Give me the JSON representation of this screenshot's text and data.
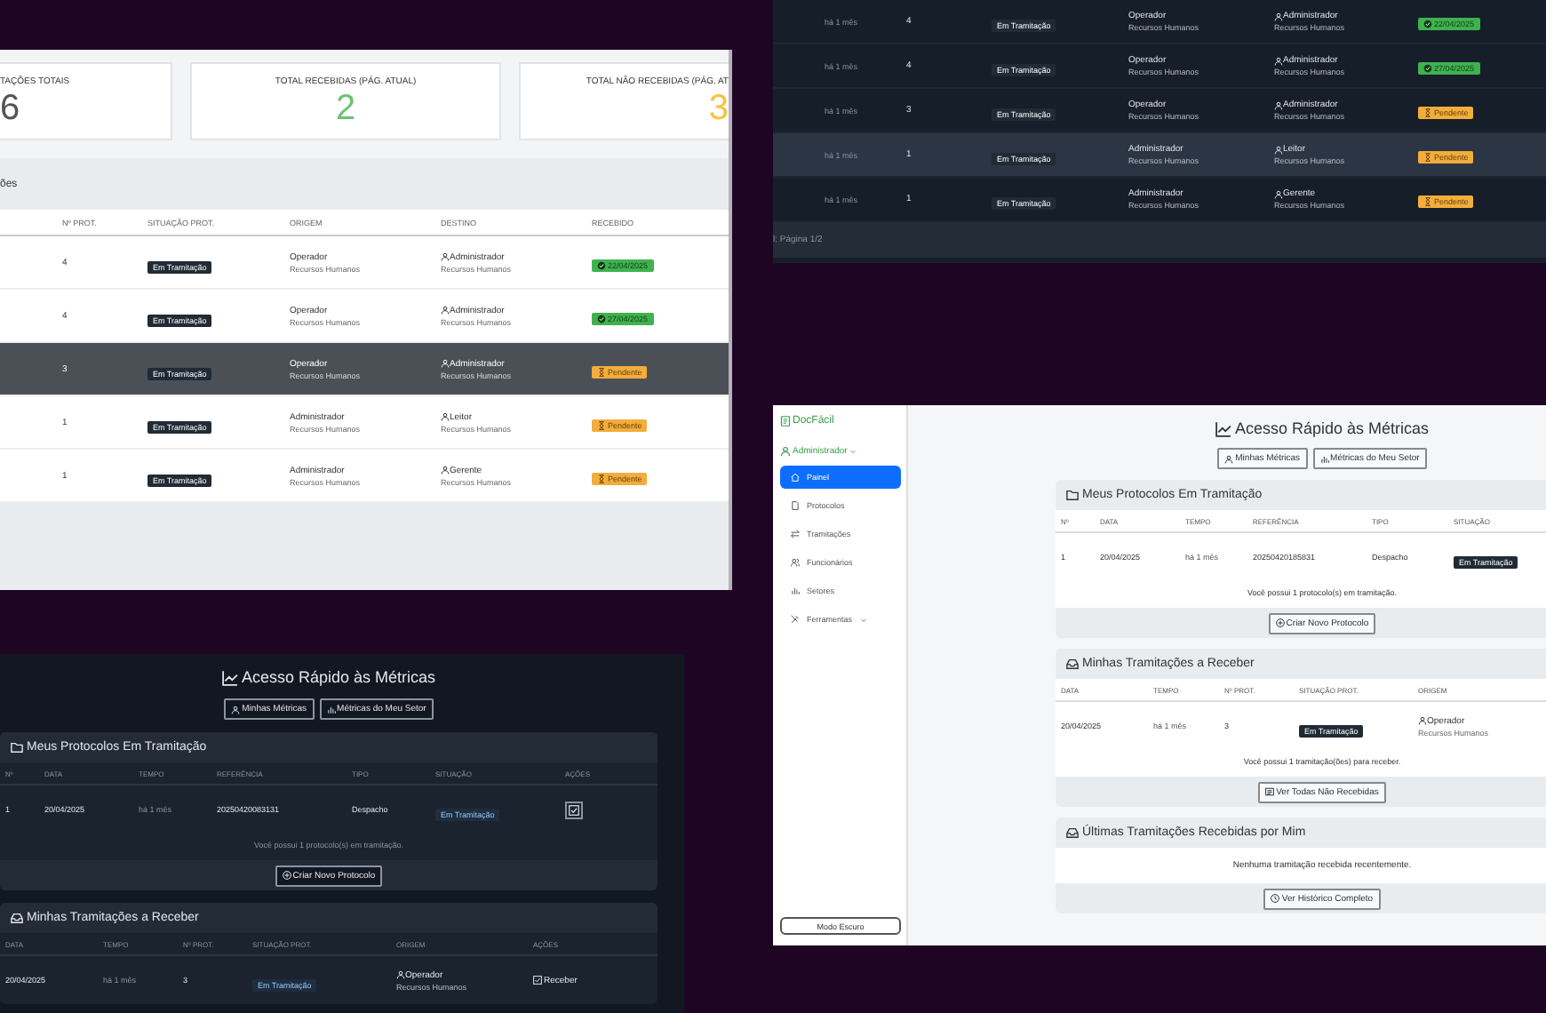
{
  "report_light": {
    "stat_cards": [
      {
        "label": "TAÇÕES TOTAIS",
        "value": "6",
        "kind": "total"
      },
      {
        "label": "TOTAL RECEBIDAS (PÁG. ATUAL)",
        "value": "2",
        "kind": "received"
      },
      {
        "label": "TOTAL NÃO RECEBIDAS (PÁG. AT",
        "value": "3",
        "kind": "pending"
      }
    ],
    "section_title": "ões",
    "columns": [
      "Nº PROT.",
      "SITUAÇÃO PROT.",
      "ORIGEM",
      "DESTINO",
      "RECEBIDO"
    ],
    "rows": [
      {
        "protocol": "4",
        "status": "Em Tramitação",
        "origin": "Operador",
        "origin_sector": "Recursos Humanos",
        "destination": "Administrador",
        "destination_sector": "Recursos Humanos",
        "received": true,
        "received_label": "22/04/2025",
        "highlighted": false
      },
      {
        "protocol": "4",
        "status": "Em Tramitação",
        "origin": "Operador",
        "origin_sector": "Recursos Humanos",
        "destination": "Administrador",
        "destination_sector": "Recursos Humanos",
        "received": true,
        "received_label": "27/04/2025",
        "highlighted": false
      },
      {
        "protocol": "3",
        "status": "Em Tramitação",
        "origin": "Operador",
        "origin_sector": "Recursos Humanos",
        "destination": "Administrador",
        "destination_sector": "Recursos Humanos",
        "received": false,
        "received_label": "Pendente",
        "highlighted": true
      },
      {
        "protocol": "1",
        "status": "Em Tramitação",
        "origin": "Administrador",
        "origin_sector": "Recursos Humanos",
        "destination": "Leitor",
        "destination_sector": "Recursos Humanos",
        "received": false,
        "received_label": "Pendente",
        "highlighted": false
      },
      {
        "protocol": "1",
        "status": "Em Tramitação",
        "origin": "Administrador",
        "origin_sector": "Recursos Humanos",
        "destination": "Gerente",
        "destination_sector": "Recursos Humanos",
        "received": false,
        "received_label": "Pendente",
        "highlighted": false
      }
    ]
  },
  "report_dark": {
    "rows": [
      {
        "time": "há 1 mês",
        "protocol": "4",
        "status": "Em Tramitação",
        "origin": "Operador",
        "origin_sector": "Recursos Humanos",
        "destination": "Administrador",
        "destination_sector": "Recursos Humanos",
        "received": true,
        "received_label": "22/04/2025",
        "highlighted": false
      },
      {
        "time": "há 1 mês",
        "protocol": "4",
        "status": "Em Tramitação",
        "origin": "Operador",
        "origin_sector": "Recursos Humanos",
        "destination": "Administrador",
        "destination_sector": "Recursos Humanos",
        "received": true,
        "received_label": "27/04/2025",
        "highlighted": false
      },
      {
        "time": "há 1 mês",
        "protocol": "3",
        "status": "Em Tramitação",
        "origin": "Operador",
        "origin_sector": "Recursos Humanos",
        "destination": "Administrador",
        "destination_sector": "Recursos Humanos",
        "received": false,
        "received_label": "Pendente",
        "highlighted": false
      },
      {
        "time": "há 1 mês",
        "protocol": "1",
        "status": "Em Tramitação",
        "origin": "Administrador",
        "origin_sector": "Recursos Humanos",
        "destination": "Leitor",
        "destination_sector": "Recursos Humanos",
        "received": false,
        "received_label": "Pendente",
        "highlighted": true
      },
      {
        "time": "há 1 mês",
        "protocol": "1",
        "status": "Em Tramitação",
        "origin": "Administrador",
        "origin_sector": "Recursos Humanos",
        "destination": "Gerente",
        "destination_sector": "Recursos Humanos",
        "received": false,
        "received_label": "Pendente",
        "highlighted": false
      }
    ],
    "pagination": "l: Página 1/2"
  },
  "dashboard_light": {
    "sidebar": {
      "brand": "DocFácil",
      "user": "Administrador",
      "nav": [
        {
          "label": "Painel",
          "selected": true,
          "has_submenu": false
        },
        {
          "label": "Protocolos",
          "selected": false,
          "has_submenu": false
        },
        {
          "label": "Tramitações",
          "selected": false,
          "has_submenu": false
        },
        {
          "label": "Funcionários",
          "selected": false,
          "has_submenu": false
        },
        {
          "label": "Setores",
          "selected": false,
          "has_submenu": false
        },
        {
          "label": "Ferramentas",
          "selected": false,
          "has_submenu": true
        }
      ],
      "dark_mode_button": "Modo Escuro"
    },
    "heading": "Acesso Rápido às Métricas",
    "metric_buttons": [
      "Minhas Métricas",
      "Métricas do Meu Setor"
    ],
    "protocols_card": {
      "title": "Meus Protocolos Em Tramitação",
      "columns": [
        "Nº",
        "DATA",
        "TEMPO",
        "REFERÊNCIA",
        "TIPO",
        "SITUAÇÃO"
      ],
      "rows": [
        {
          "number": "1",
          "date": "20/04/2025",
          "time": "há 1 mês",
          "reference": "20250420185831",
          "type": "Despacho",
          "status": "Em Tramitação"
        }
      ],
      "summary": "Você possui 1 protocolo(s) em tramitação.",
      "button": "Criar Novo Protocolo"
    },
    "incoming_card": {
      "title": "Minhas Tramitações a Receber",
      "columns": [
        "DATA",
        "TEMPO",
        "Nº PROT.",
        "SITUAÇÃO PROT.",
        "ORIGEM"
      ],
      "rows": [
        {
          "date": "20/04/2025",
          "time": "há 1 mês",
          "protocol": "3",
          "status": "Em Tramitação",
          "origin": "Operador",
          "origin_sector": "Recursos Humanos"
        }
      ],
      "summary": "Você possui 1 tramitação(ões) para receber.",
      "button": "Ver Todas Não Recebidas"
    },
    "recent_card": {
      "title": "Últimas Tramitações Recebidas por Mim",
      "empty_text": "Nenhuma tramitação recebida recentemente.",
      "button": "Ver Histórico Completo"
    }
  },
  "dashboard_dark": {
    "heading": "Acesso Rápido às Métricas",
    "metric_buttons": [
      "Minhas Métricas",
      "Métricas do Meu Setor"
    ],
    "protocols_card": {
      "title": "Meus Protocolos Em Tramitação",
      "columns": [
        "Nº",
        "DATA",
        "TEMPO",
        "REFERÊNCIA",
        "TIPO",
        "SITUAÇÃO",
        "AÇÕES"
      ],
      "rows": [
        {
          "number": "1",
          "date": "20/04/2025",
          "time": "há 1 mês",
          "reference": "20250420083131",
          "type": "Despacho",
          "status": "Em Tramitação",
          "has_action": true
        }
      ],
      "summary": "Você possui 1 protocolo(s) em tramitação.",
      "button": "Criar Novo Protocolo"
    },
    "incoming_card": {
      "title": "Minhas Tramitações a Receber",
      "columns": [
        "DATA",
        "TEMPO",
        "Nº PROT.",
        "SITUAÇÃO PROT.",
        "ORIGEM",
        "AÇÕES"
      ],
      "rows": [
        {
          "date": "20/04/2025",
          "time": "há 1 mês",
          "protocol": "3",
          "status": "Em Tramitação",
          "origin": "Operador",
          "origin_sector": "Recursos Humanos",
          "action_label": "Receber"
        }
      ]
    }
  }
}
